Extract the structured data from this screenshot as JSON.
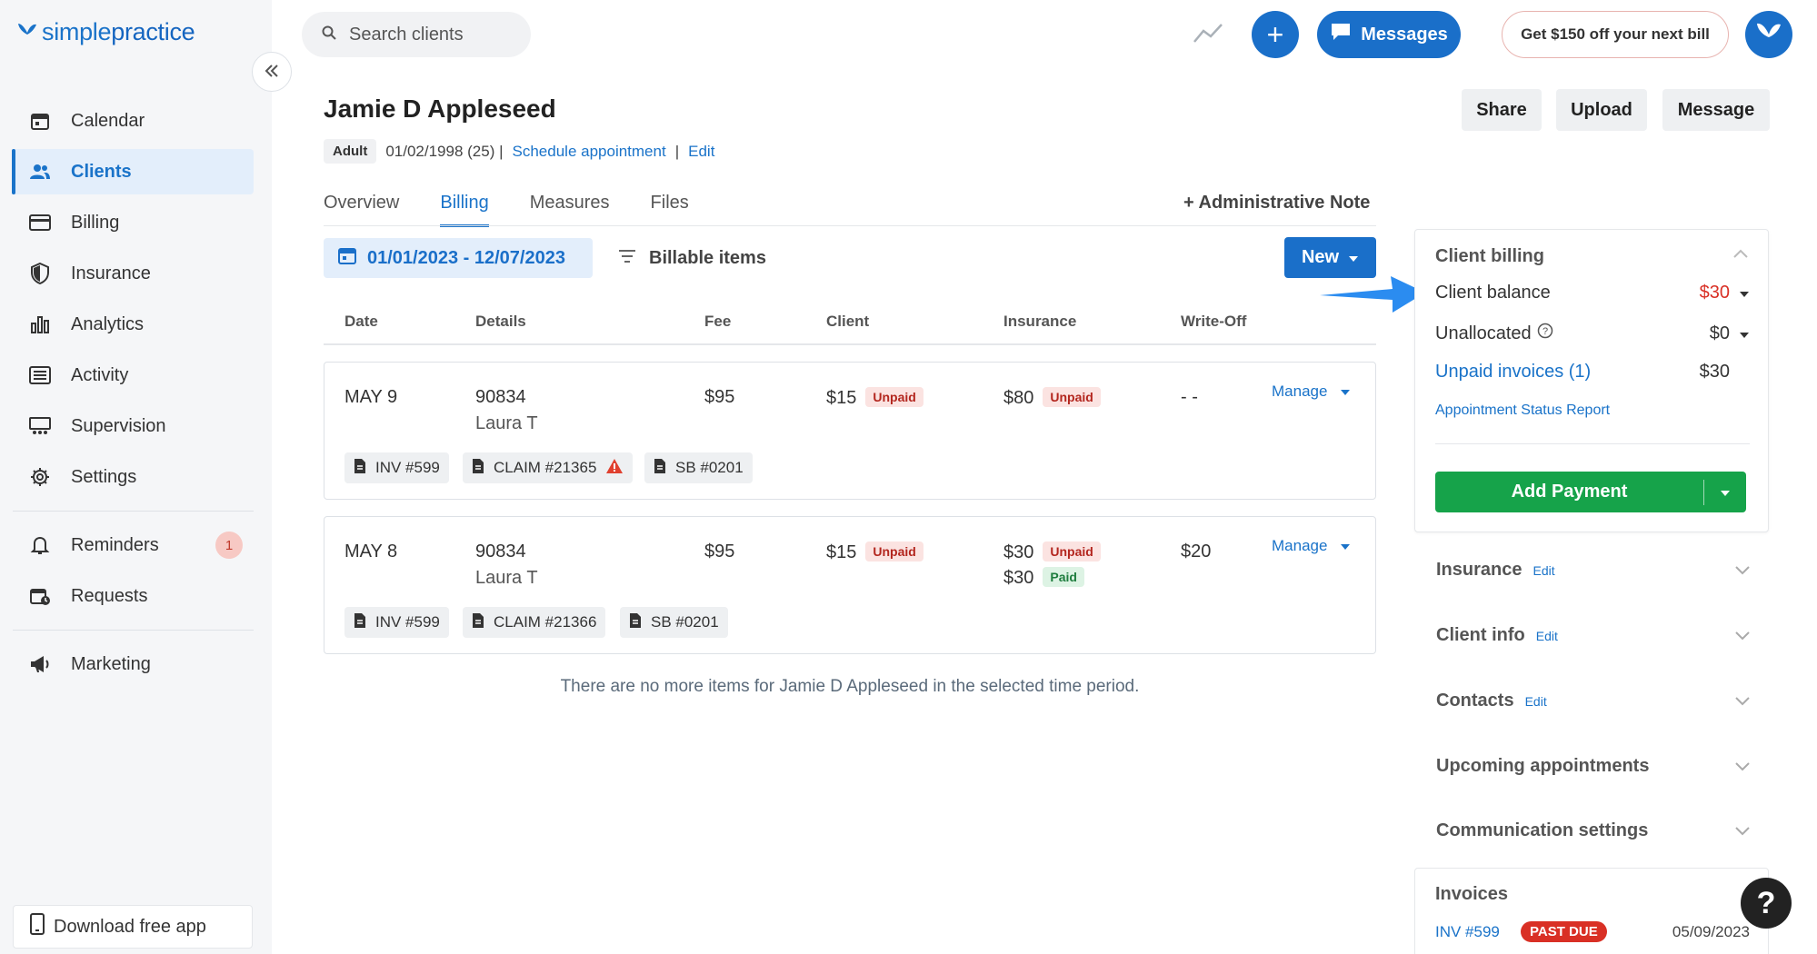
{
  "brand": {
    "logo_simple": "simple",
    "logo_practice": "practice"
  },
  "sidebar": {
    "items": [
      {
        "label": "Calendar",
        "icon": "calendar-icon"
      },
      {
        "label": "Clients",
        "icon": "clients-icon",
        "active": true
      },
      {
        "label": "Billing",
        "icon": "billing-icon"
      },
      {
        "label": "Insurance",
        "icon": "shield-icon"
      },
      {
        "label": "Analytics",
        "icon": "analytics-icon"
      },
      {
        "label": "Activity",
        "icon": "activity-icon"
      },
      {
        "label": "Supervision",
        "icon": "supervision-icon"
      },
      {
        "label": "Settings",
        "icon": "gear-icon"
      }
    ],
    "reminders_label": "Reminders",
    "reminders_badge": "1",
    "requests_label": "Requests",
    "marketing_label": "Marketing",
    "download_label": "Download free app"
  },
  "topbar": {
    "search_placeholder": "Search clients",
    "plus_label": "+",
    "messages_label": "Messages",
    "promo_label": "Get $150 off your next bill"
  },
  "client": {
    "name": "Jamie D Appleseed",
    "type": "Adult",
    "dob": "01/02/1998 (25) |",
    "schedule_link": "Schedule appointment",
    "sep": "|",
    "edit_link": "Edit"
  },
  "header_actions": {
    "share": "Share",
    "upload": "Upload",
    "message": "Message"
  },
  "tabs": [
    {
      "label": "Overview"
    },
    {
      "label": "Billing",
      "active": true
    },
    {
      "label": "Measures"
    },
    {
      "label": "Files"
    }
  ],
  "admin_note": "+ Administrative Note",
  "filters": {
    "date_range": "01/01/2023 - 12/07/2023",
    "billable": "Billable items",
    "new_label": "New"
  },
  "table": {
    "headers": {
      "date": "Date",
      "details": "Details",
      "fee": "Fee",
      "client": "Client",
      "insurance": "Insurance",
      "writeoff": "Write-Off"
    },
    "rows": [
      {
        "date": "MAY 9",
        "code": "90834",
        "provider": "Laura T",
        "fee": "$95",
        "client_amt": "$15",
        "client_status": "Unpaid",
        "ins1_amt": "$80",
        "ins1_status": "Unpaid",
        "writeoff": "- -",
        "manage": "Manage",
        "docs": [
          "INV #599",
          "CLAIM #21365",
          "SB #0201"
        ]
      },
      {
        "date": "MAY 8",
        "code": "90834",
        "provider": "Laura T",
        "fee": "$95",
        "client_amt": "$15",
        "client_status": "Unpaid",
        "ins1_amt": "$30",
        "ins1_status": "Unpaid",
        "ins2_amt": "$30",
        "ins2_status": "Paid",
        "writeoff": "$20",
        "manage": "Manage",
        "docs": [
          "INV #599",
          "CLAIM #21366",
          "SB #0201"
        ]
      }
    ],
    "empty_message": "There are no more items for Jamie D Appleseed in the selected time period."
  },
  "billing_panel": {
    "title": "Client billing",
    "balance_label": "Client balance",
    "balance_value": "$30",
    "unallocated_label": "Unallocated",
    "unallocated_value": "$0",
    "unpaid_label": "Unpaid invoices (1)",
    "unpaid_value": "$30",
    "status_report": "Appointment Status Report",
    "add_payment": "Add Payment"
  },
  "sections": [
    {
      "title": "Insurance",
      "edit": "Edit"
    },
    {
      "title": "Client info",
      "edit": "Edit"
    },
    {
      "title": "Contacts",
      "edit": "Edit"
    },
    {
      "title": "Upcoming appointments",
      "edit": ""
    },
    {
      "title": "Communication settings",
      "edit": ""
    }
  ],
  "invoices": {
    "title": "Invoices",
    "inv": "INV #599",
    "status": "PAST DUE",
    "date": "05/09/2023"
  },
  "help_label": "?",
  "colors": {
    "brand_blue": "#1a6fc9",
    "accent_red": "#d93025",
    "success_green": "#16a34a"
  }
}
